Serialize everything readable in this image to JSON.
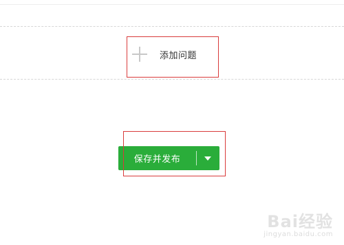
{
  "questions": {
    "add_label": "添加问题",
    "add_icon": "plus-icon"
  },
  "actions": {
    "save_publish_label": "保存并发布",
    "dropdown_icon": "caret-down-icon",
    "primary_color": "#2aad3a"
  },
  "annotations": {
    "highlight_color": "#d93a3a"
  },
  "watermark": {
    "brand": "Bai经验",
    "url": "jingyan.baidu.com"
  }
}
